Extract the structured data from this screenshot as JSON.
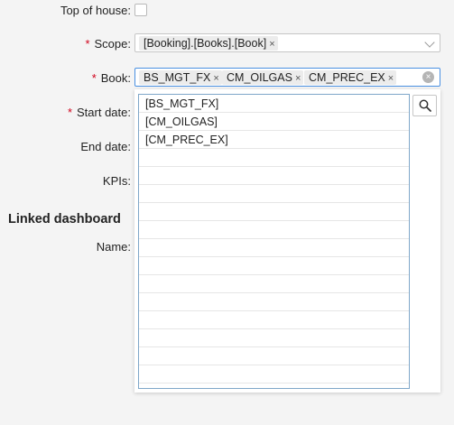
{
  "form": {
    "top_of_house": {
      "label": "Top of house:",
      "checked": false
    },
    "scope": {
      "label": "Scope:",
      "required_mark": "*",
      "tags": [
        "[Booking].[Books].[Book]"
      ]
    },
    "book": {
      "label": "Book:",
      "required_mark": "*",
      "tags": [
        "BS_MGT_FX",
        "CM_OILGAS",
        "CM_PREC_EX"
      ]
    },
    "start_date": {
      "label": "Start date:",
      "required_mark": "*"
    },
    "end_date": {
      "label": "End date:"
    },
    "kpis": {
      "label": "KPIs:"
    }
  },
  "linked_dashboard": {
    "title": "Linked dashboard",
    "name_label": "Name:"
  },
  "dropdown": {
    "options": [
      "[BS_MGT_FX]",
      "[CM_OILGAS]",
      "[CM_PREC_EX]"
    ],
    "empty_rows": 13,
    "search_icon": "search-icon"
  },
  "icons": {
    "remove": "×",
    "clear": "×"
  }
}
